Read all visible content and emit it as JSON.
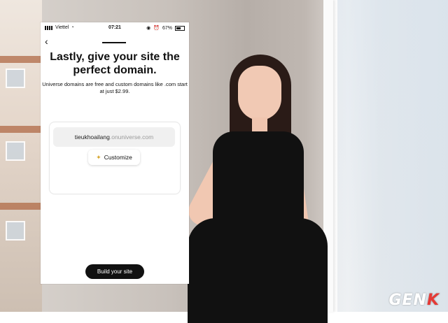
{
  "status_bar": {
    "carrier": "Viettel",
    "time": "07:21",
    "battery_percent": "67%"
  },
  "screen": {
    "title": "Lastly, give your site the perfect domain.",
    "subtitle": "Universe domains are free and custom domains like .com start at just $2.99.",
    "domain": {
      "name": "tieukhoailang",
      "suffix": ".onuniverse.com"
    },
    "customize_label": "Customize",
    "primary_button_label": "Build your site"
  },
  "watermark": {
    "text_left": "GEN",
    "text_right": "K"
  },
  "icons": {
    "back": "chevron-left-icon",
    "sparkle": "sparkle-icon"
  }
}
